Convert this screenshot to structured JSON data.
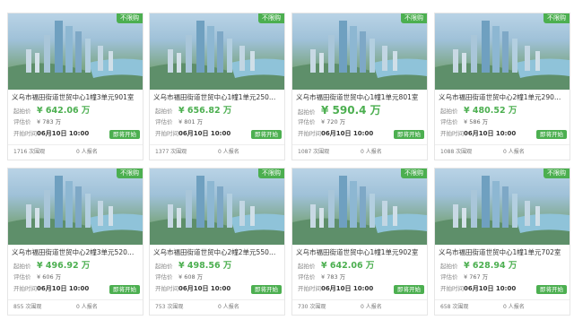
{
  "labels": {
    "tag": "不限购",
    "start_price": "起拍价",
    "est_price": "评估价",
    "start_time": "开拍时间",
    "button": "即将开始"
  },
  "cards": [
    {
      "title": "义乌市福田街道世贸中心1幢3单元901室",
      "price": "¥ 642.06 万",
      "est": "¥ 783 万",
      "time": "06月10日 10:00",
      "views": "1716 次围观",
      "reg": "0 人报名"
    },
    {
      "title": "义乌市福田街道世贸中心1幢1单元250…",
      "price": "¥ 656.82 万",
      "est": "¥ 801 万",
      "time": "06月10日 10:00",
      "views": "1377 次围观",
      "reg": "0 人报名"
    },
    {
      "title": "义乌市福田街道世贸中心1幢1单元801室",
      "price": "¥ 590.4 万",
      "est": "¥ 720 万",
      "time": "06月10日 10:00",
      "views": "1087 次围观",
      "reg": "0 人报名"
    },
    {
      "title": "义乌市福田街道世贸中心2幢1单元290…",
      "price": "¥ 480.52 万",
      "est": "¥ 586 万",
      "time": "06月10日 10:00",
      "views": "1088 次围观",
      "reg": "0 人报名"
    },
    {
      "title": "义乌市福田街道世贸中心2幢3单元520…",
      "price": "¥ 496.92 万",
      "est": "¥ 606 万",
      "time": "06月10日 10:00",
      "views": "855 次围观",
      "reg": "0 人报名"
    },
    {
      "title": "义乌市福田街道世贸中心2幢2单元550…",
      "price": "¥ 498.56 万",
      "est": "¥ 608 万",
      "time": "06月10日 10:00",
      "views": "753 次围观",
      "reg": "0 人报名"
    },
    {
      "title": "义乌市福田街道世贸中心1幢1单元902室",
      "price": "¥ 642.06 万",
      "est": "¥ 783 万",
      "time": "06月10日 10:00",
      "views": "730 次围观",
      "reg": "0 人报名"
    },
    {
      "title": "义乌市福田街道世贸中心1幢1单元702室",
      "price": "¥ 628.94 万",
      "est": "¥ 767 万",
      "time": "06月10日 10:00",
      "views": "658 次围观",
      "reg": "0 人报名"
    }
  ]
}
